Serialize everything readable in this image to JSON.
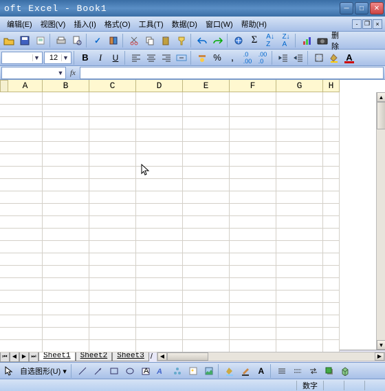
{
  "title": "oft Excel - Book1",
  "menus": [
    "编辑(E)",
    "视图(V)",
    "插入(I)",
    "格式(O)",
    "工具(T)",
    "数据(D)",
    "窗口(W)",
    "帮助(H)"
  ],
  "toolbar_delete_label": "删除",
  "font_size": "12",
  "bold_label": "B",
  "italic_label": "I",
  "underline_label": "U",
  "percent_label": "%",
  "columns": [
    "A",
    "B",
    "C",
    "D",
    "E",
    "F",
    "G",
    "H"
  ],
  "sheets": [
    "Sheet1",
    "Sheet2",
    "Sheet3"
  ],
  "active_sheet": 0,
  "autoshapes_label": "自选图形(U)",
  "status_mode": "数字",
  "fx_label": "fx",
  "namebox_value": ""
}
